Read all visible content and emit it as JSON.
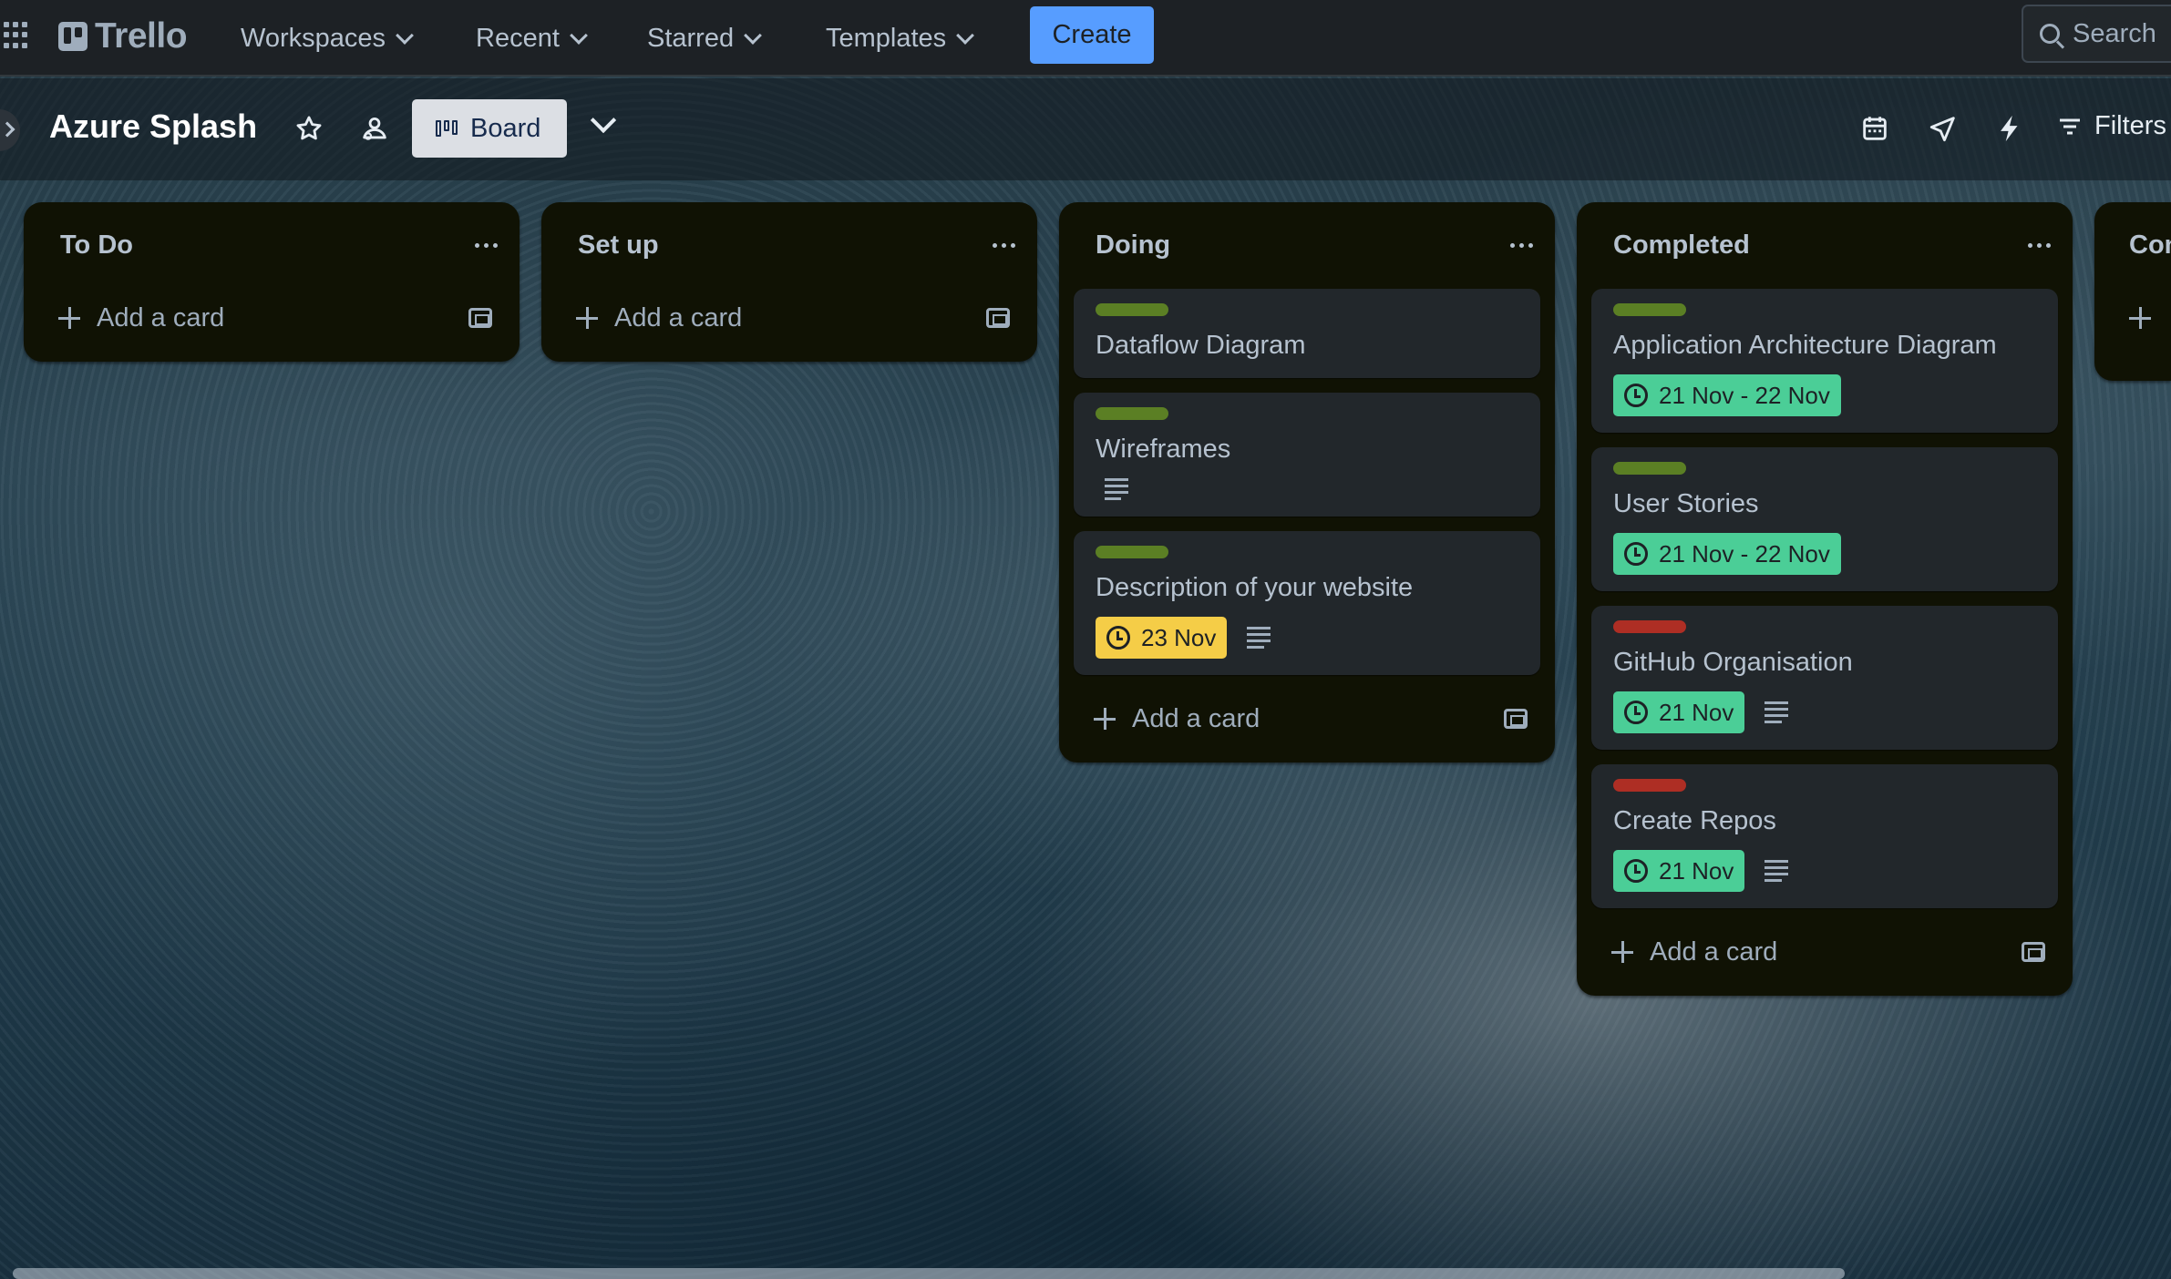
{
  "nav": {
    "logo": "Trello",
    "items": [
      {
        "label": "Workspaces"
      },
      {
        "label": "Recent"
      },
      {
        "label": "Starred"
      },
      {
        "label": "Templates"
      }
    ],
    "create_label": "Create",
    "search_placeholder": "Search"
  },
  "board": {
    "title": "Azure Splash",
    "view_label": "Board",
    "filters_label": "Filters"
  },
  "colors": {
    "label_green": "#5b7f24",
    "label_red": "#ae2e24",
    "badge_green": "#4bce97",
    "badge_yellow": "#f5cd47"
  },
  "lists": [
    {
      "title": "To Do",
      "add_label": "Add a card",
      "cards": []
    },
    {
      "title": "Set up",
      "add_label": "Add a card",
      "cards": []
    },
    {
      "title": "Doing",
      "add_label": "Add a card",
      "cards": [
        {
          "title": "Dataflow Diagram",
          "label_color": "green"
        },
        {
          "title": "Wireframes",
          "label_color": "green",
          "has_description": true
        },
        {
          "title": "Description of your website",
          "label_color": "green",
          "date": "23 Nov",
          "date_status": "yellow",
          "has_description": true
        }
      ]
    },
    {
      "title": "Completed",
      "add_label": "Add a card",
      "cards": [
        {
          "title": "Application Architecture Diagram",
          "label_color": "green",
          "date": "21 Nov - 22 Nov",
          "date_status": "green"
        },
        {
          "title": "User Stories",
          "label_color": "green",
          "date": "21 Nov - 22 Nov",
          "date_status": "green"
        },
        {
          "title": "GitHub Organisation",
          "label_color": "red",
          "date": "21 Nov",
          "date_status": "green",
          "has_description": true
        },
        {
          "title": "Create Repos",
          "label_color": "red",
          "date": "21 Nov",
          "date_status": "green",
          "has_description": true
        }
      ]
    },
    {
      "title": "Con",
      "cards": []
    }
  ]
}
